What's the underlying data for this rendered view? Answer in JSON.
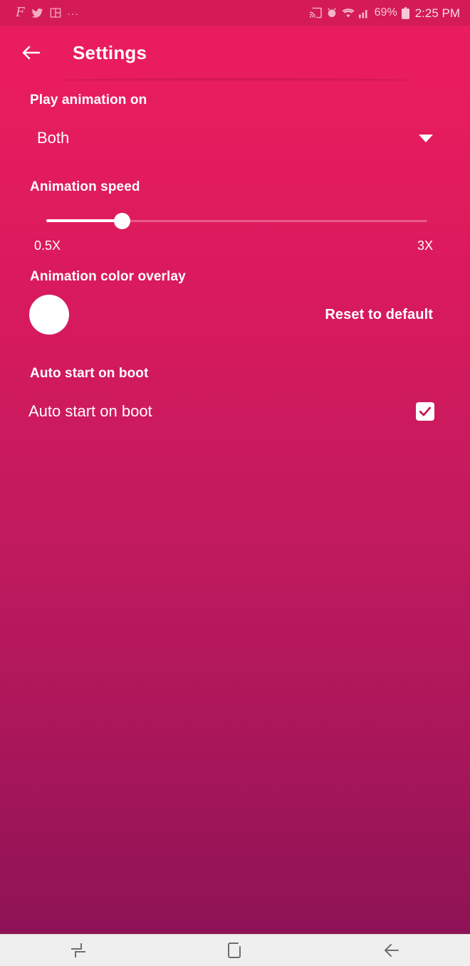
{
  "status_bar": {
    "left_icons": [
      {
        "name": "facebook-messenger-icon",
        "glyph": "F"
      },
      {
        "name": "twitter-icon"
      },
      {
        "name": "app-layout-icon"
      },
      {
        "name": "more-notifications-ellipsis",
        "glyph": "..."
      }
    ],
    "right_icons": [
      {
        "name": "cast-screen-icon"
      },
      {
        "name": "alarm-clock-icon"
      },
      {
        "name": "wifi-icon"
      },
      {
        "name": "signal-bars-icon"
      }
    ],
    "battery_percent": "69%",
    "clock": "2:25 PM"
  },
  "header": {
    "title": "Settings",
    "back_icon": "arrow-left-icon"
  },
  "sections": {
    "play_animation": {
      "title": "Play animation on",
      "selected_value": "Both",
      "dropdown_icon": "caret-down-icon"
    },
    "animation_speed": {
      "title": "Animation speed",
      "min_label": "0.5X",
      "max_label": "3X",
      "value_percent": 20
    },
    "color_overlay": {
      "title": "Animation color overlay",
      "swatch_color": "#ffffff",
      "reset_label": "Reset to default"
    },
    "auto_start": {
      "title": "Auto start on boot",
      "row_label": "Auto start on boot",
      "checked": true
    }
  },
  "nav_bar": {
    "recents_label": "recents-icon",
    "home_label": "home-icon",
    "back_label": "back-icon"
  },
  "theme": {
    "accent_top": "#e81c5e",
    "accent_bottom": "#8d1356",
    "status_bar_bg": "#d41a57",
    "on_accent": "#ffffff",
    "nav_bg": "#efefef"
  }
}
